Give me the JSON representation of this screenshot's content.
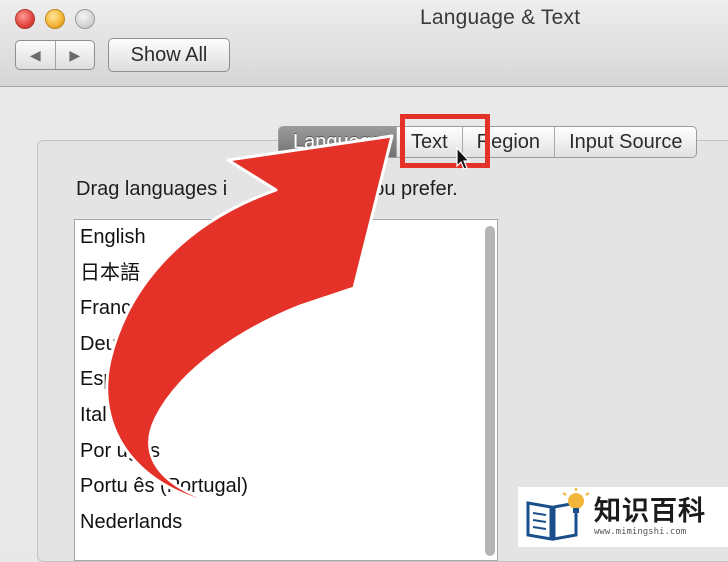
{
  "window": {
    "title": "Language & Text",
    "show_all_label": "Show All",
    "back_glyph": "◀",
    "forward_glyph": "▶"
  },
  "tabs": [
    {
      "label": "Language",
      "active": true
    },
    {
      "label": "Text",
      "active": false
    },
    {
      "label": "Region",
      "active": false
    },
    {
      "label": "Input Source",
      "active": false
    }
  ],
  "content": {
    "drag_label_visible_start": "Drag languages i",
    "drag_label_visible_end": "you prefer.",
    "languages": [
      "English",
      "日本語",
      "Françai",
      "Deuts",
      "Espa",
      "Ital o",
      "Por ugês",
      "Portu ês (Portugal)",
      "Nederlands"
    ]
  },
  "annotation": {
    "highlight_color": "#e53228",
    "arrow_color": "#e53228",
    "highlights": "Text tab"
  },
  "watermark": {
    "brand": "知识百科",
    "url": "www.mimingshi.com"
  }
}
